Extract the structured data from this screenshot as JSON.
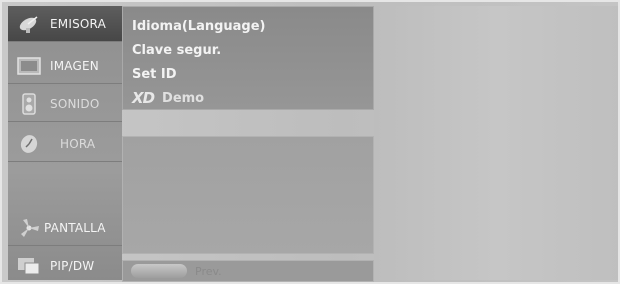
{
  "sidebar": {
    "items": [
      {
        "label": "EMISORA",
        "icon": "satellite-dish-icon",
        "selected": true
      },
      {
        "label": "IMAGEN",
        "icon": "screen-icon",
        "selected": false
      },
      {
        "label": "SONIDO",
        "icon": "speaker-icon",
        "selected": false
      },
      {
        "label": "HORA",
        "icon": "clock-icon",
        "selected": false
      },
      {
        "label": "PANTALLA",
        "icon": "fan-icon",
        "selected": false
      },
      {
        "label": "PIP/DW",
        "icon": "pip-icon",
        "selected": false
      }
    ]
  },
  "submenu": {
    "items": [
      {
        "label": "Idioma(Language)"
      },
      {
        "label": "Clave segur."
      },
      {
        "label": "Set ID"
      },
      {
        "logo": "XD",
        "label": "Demo"
      }
    ]
  },
  "footer": {
    "prev_label": "Prev."
  }
}
